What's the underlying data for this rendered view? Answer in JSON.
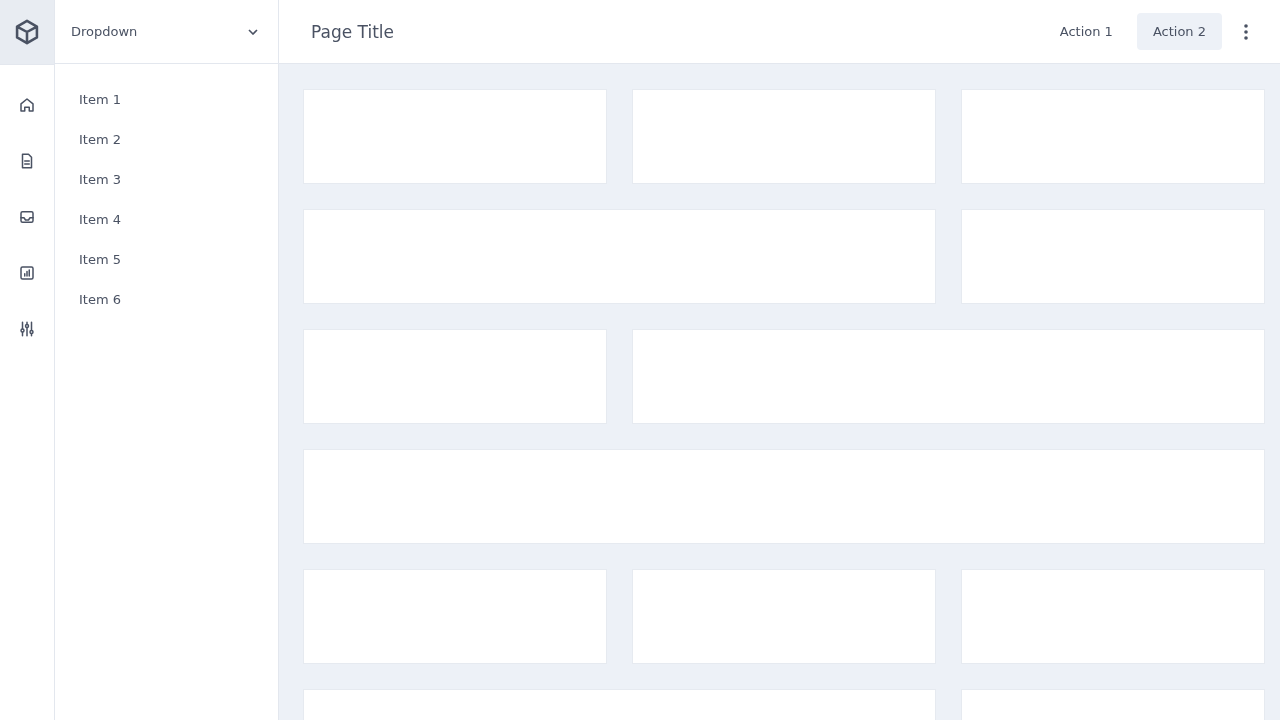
{
  "rail": {
    "icons": [
      {
        "kind": "home"
      },
      {
        "kind": "document"
      },
      {
        "kind": "inbox"
      },
      {
        "kind": "chart"
      },
      {
        "kind": "sliders"
      }
    ]
  },
  "dropdown": {
    "label": "Dropdown"
  },
  "sidebar": {
    "items": [
      {
        "label": "Item 1"
      },
      {
        "label": "Item 2"
      },
      {
        "label": "Item 3"
      },
      {
        "label": "Item 4"
      },
      {
        "label": "Item 5"
      },
      {
        "label": "Item 6"
      }
    ]
  },
  "header": {
    "title": "Page Title",
    "actions": [
      {
        "label": "Action 1",
        "selected": false
      },
      {
        "label": "Action 2",
        "selected": true
      }
    ]
  },
  "cards": [
    {
      "kind": "narrow"
    },
    {
      "kind": "narrow"
    },
    {
      "kind": "narrow"
    },
    {
      "kind": "wide"
    },
    {
      "kind": "narrow"
    },
    {
      "kind": "narrow"
    },
    {
      "kind": "wide"
    },
    {
      "kind": "full"
    },
    {
      "kind": "narrow"
    },
    {
      "kind": "narrow"
    },
    {
      "kind": "narrow"
    },
    {
      "kind": "wide"
    },
    {
      "kind": "narrow"
    }
  ]
}
